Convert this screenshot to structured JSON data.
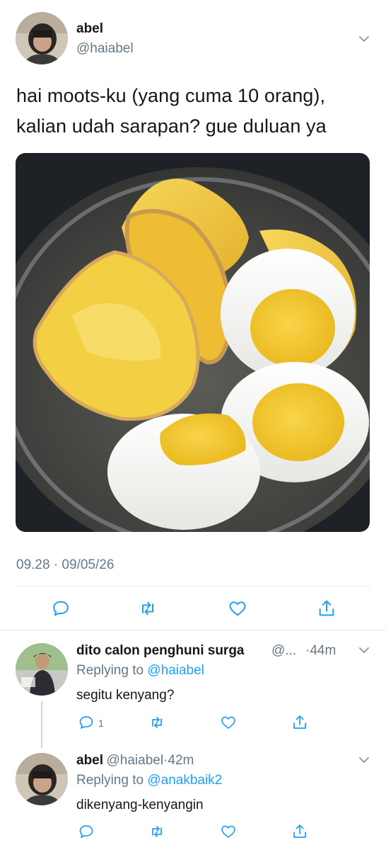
{
  "main_tweet": {
    "author_name": "abel",
    "author_handle": "@haiabel",
    "text_line1": "hai moots-ku (yang cuma 10 orang),",
    "text_line2": "kalian udah sarapan? gue duluan ya",
    "timestamp": "09.28 · 09/05/26"
  },
  "replies": [
    {
      "author_name": "dito calon penghuni surga",
      "author_handle": "@...",
      "time": "·44m",
      "replying_prefix": "Replying to",
      "replying_to": "@haiabel",
      "text": "segitu kenyang?",
      "reply_count": "1"
    },
    {
      "author_name": "abel",
      "author_handle": "@haiabel",
      "time": "·42m",
      "replying_prefix": "Replying to",
      "replying_to": "@anakbaik2",
      "text": "dikenyang-kenyangin",
      "reply_count": ""
    }
  ],
  "colors": {
    "accent": "#1da1f2",
    "muted": "#657786",
    "divider": "#e1e8ed"
  },
  "icons": [
    "chevron-down-icon",
    "reply-icon",
    "retweet-icon",
    "like-icon",
    "share-icon"
  ]
}
